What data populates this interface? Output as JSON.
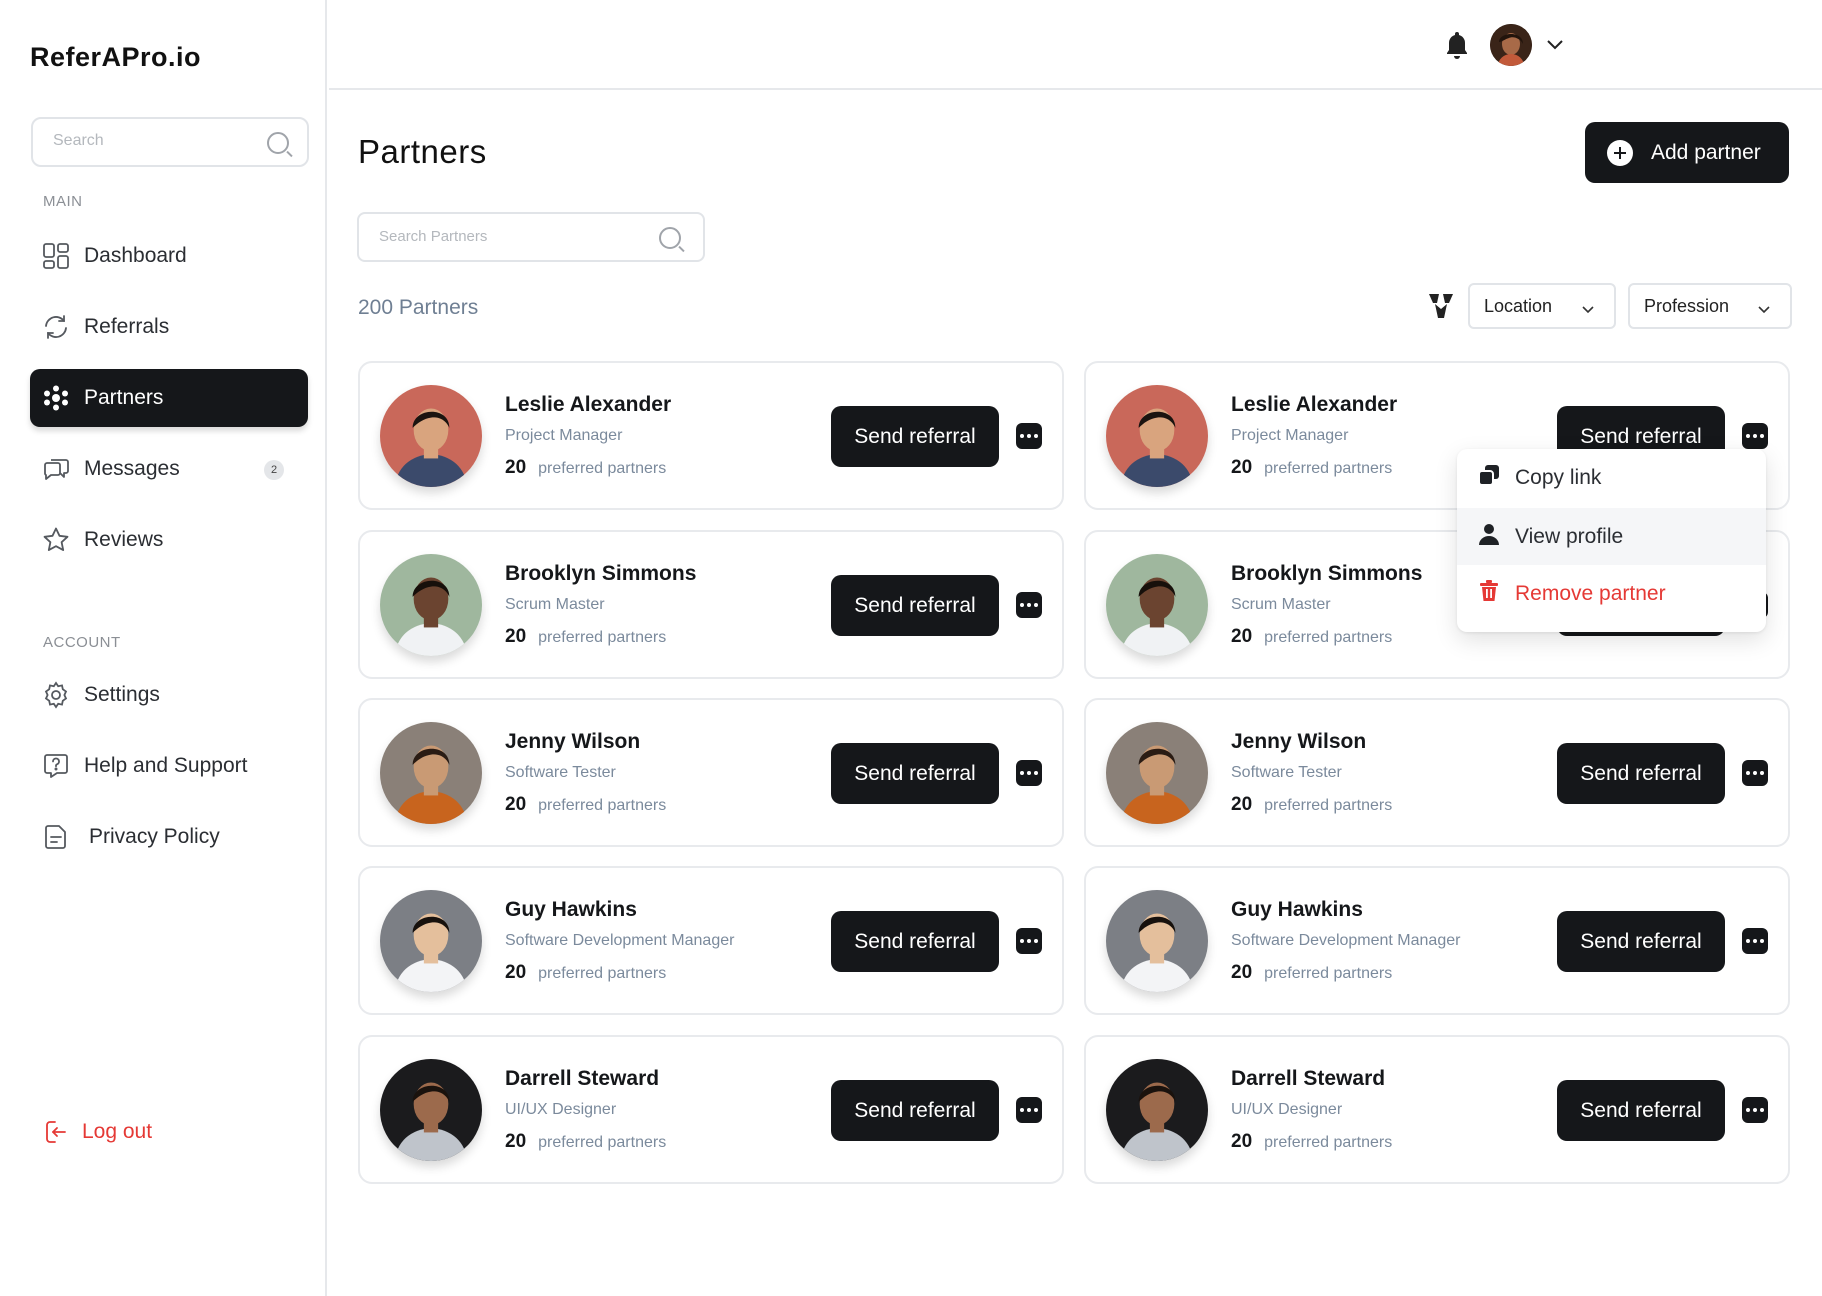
{
  "app": {
    "name": "ReferAPro.io"
  },
  "sidebar": {
    "search_placeholder": "Search",
    "main_label": "MAIN",
    "account_label": "ACCOUNT",
    "main_items": [
      {
        "label": "Dashboard",
        "icon": "dashboard-icon"
      },
      {
        "label": "Referrals",
        "icon": "refresh-icon"
      },
      {
        "label": "Partners",
        "icon": "partners-icon",
        "active": true
      },
      {
        "label": "Messages",
        "icon": "messages-icon",
        "badge": "2"
      },
      {
        "label": "Reviews",
        "icon": "star-icon"
      }
    ],
    "account_items": [
      {
        "label": "Settings",
        "icon": "gear-icon"
      },
      {
        "label": "Help and Support",
        "icon": "help-icon"
      },
      {
        "label": "Privacy Policy",
        "icon": "document-icon"
      }
    ],
    "logout_label": "Log out"
  },
  "header": {
    "notification_icon": "bell-icon",
    "user_menu_icon": "chevron-down-icon"
  },
  "main": {
    "title": "Partners",
    "add_button_label": "Add partner",
    "search_placeholder": "Search Partners",
    "count_label": "200 Partners",
    "filters": {
      "location": "Location",
      "profession": "Profession"
    }
  },
  "partners": [
    {
      "name": "Leslie Alexander",
      "role": "Project Manager",
      "preferred_count": "20",
      "preferred_label": "preferred partners"
    },
    {
      "name": "Leslie Alexander",
      "role": "Project Manager",
      "preferred_count": "20",
      "preferred_label": "preferred partners"
    },
    {
      "name": "Brooklyn Simmons",
      "role": "Scrum Master",
      "preferred_count": "20",
      "preferred_label": "preferred partners"
    },
    {
      "name": "Brooklyn Simmons",
      "role": "Scrum Master",
      "preferred_count": "20",
      "preferred_label": "preferred partners"
    },
    {
      "name": "Jenny Wilson",
      "role": "Software Tester",
      "preferred_count": "20",
      "preferred_label": "preferred partners"
    },
    {
      "name": "Jenny Wilson",
      "role": "Software Tester",
      "preferred_count": "20",
      "preferred_label": "preferred partners"
    },
    {
      "name": "Guy Hawkins",
      "role": "Software Development Manager",
      "preferred_count": "20",
      "preferred_label": "preferred partners"
    },
    {
      "name": "Guy Hawkins",
      "role": "Software Development Manager",
      "preferred_count": "20",
      "preferred_label": "preferred partners"
    },
    {
      "name": "Darrell Steward",
      "role": "UI/UX Designer",
      "preferred_count": "20",
      "preferred_label": "preferred partners"
    },
    {
      "name": "Darrell Steward",
      "role": "UI/UX Designer",
      "preferred_count": "20",
      "preferred_label": "preferred partners"
    }
  ],
  "card_actions": {
    "send_label": "Send referral"
  },
  "context_menu": {
    "items": [
      {
        "label": "Copy link",
        "icon": "copy-icon"
      },
      {
        "label": "View profile",
        "icon": "user-icon"
      },
      {
        "label": "Remove partner",
        "icon": "trash-icon"
      }
    ]
  },
  "colors": {
    "primary": "#15171a",
    "danger": "#e53935",
    "muted": "#7b8a9c",
    "border": "#e8eaed"
  }
}
